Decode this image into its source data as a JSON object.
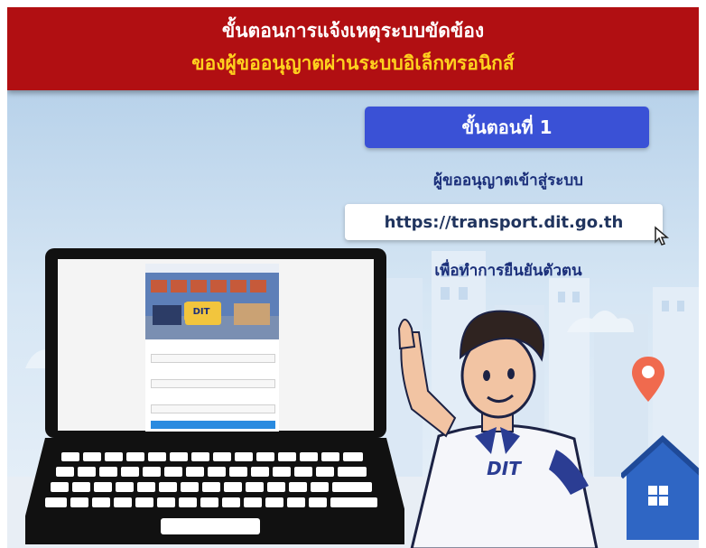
{
  "header": {
    "line1": "ขั้นตอนการแจ้งเหตุระบบขัดข้อง",
    "line2": "ของผู้ขออนุญาตผ่านระบบอิเล็กทรอนิกส์"
  },
  "step": {
    "badge": "ขั้นตอนที่ 1",
    "text1": "ผู้ขออนุญาตเข้าสู่ระบบ",
    "url": "https://transport.dit.go.th",
    "text2": "เพื่อทำการยืนยันตัวตน"
  },
  "mascot": {
    "shirt_logo": "DIT"
  },
  "laptop_screen": {
    "banner_logo": "DIT"
  },
  "colors": {
    "header_red": "#b10f12",
    "header_yellow": "#ffd21e",
    "badge_blue": "#3a51d6",
    "text_navy": "#1b2f7a"
  },
  "icons": [
    "cursor-arrow-icon",
    "location-pin-icon",
    "house-icon"
  ]
}
